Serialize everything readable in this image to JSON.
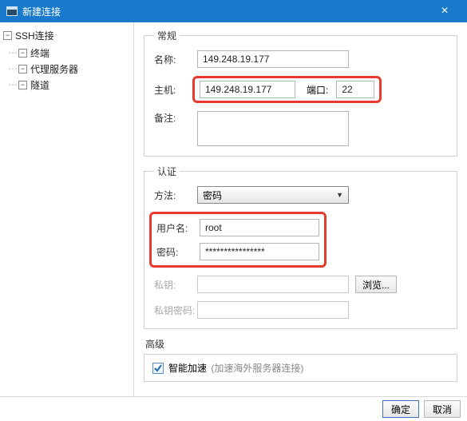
{
  "titlebar": {
    "title": "新建连接",
    "close": "×"
  },
  "sidebar": {
    "root_toggle": "−",
    "root": "SSH连接",
    "child_toggle": "−",
    "items": [
      "终端",
      "代理服务器",
      "隧道"
    ]
  },
  "general": {
    "legend": "常规",
    "name_label": "名称:",
    "name_value": "149.248.19.177",
    "host_label": "主机:",
    "host_value": "149.248.19.177",
    "port_label": "端口:",
    "port_value": "22",
    "note_label": "备注:",
    "note_value": ""
  },
  "auth": {
    "legend": "认证",
    "method_label": "方法:",
    "method_value": "密码",
    "user_label": "用户名:",
    "user_value": "root",
    "pass_label": "密码:",
    "pass_value": "****************",
    "key_label": "私钥:",
    "key_value": "",
    "browse": "浏览...",
    "keypass_label": "私钥密码:",
    "keypass_value": ""
  },
  "advanced": {
    "legend": "高级",
    "checked": true,
    "label": "智能加速",
    "hint": "(加速海外服务器连接)"
  },
  "footer": {
    "ok": "确定",
    "cancel": "取消"
  }
}
